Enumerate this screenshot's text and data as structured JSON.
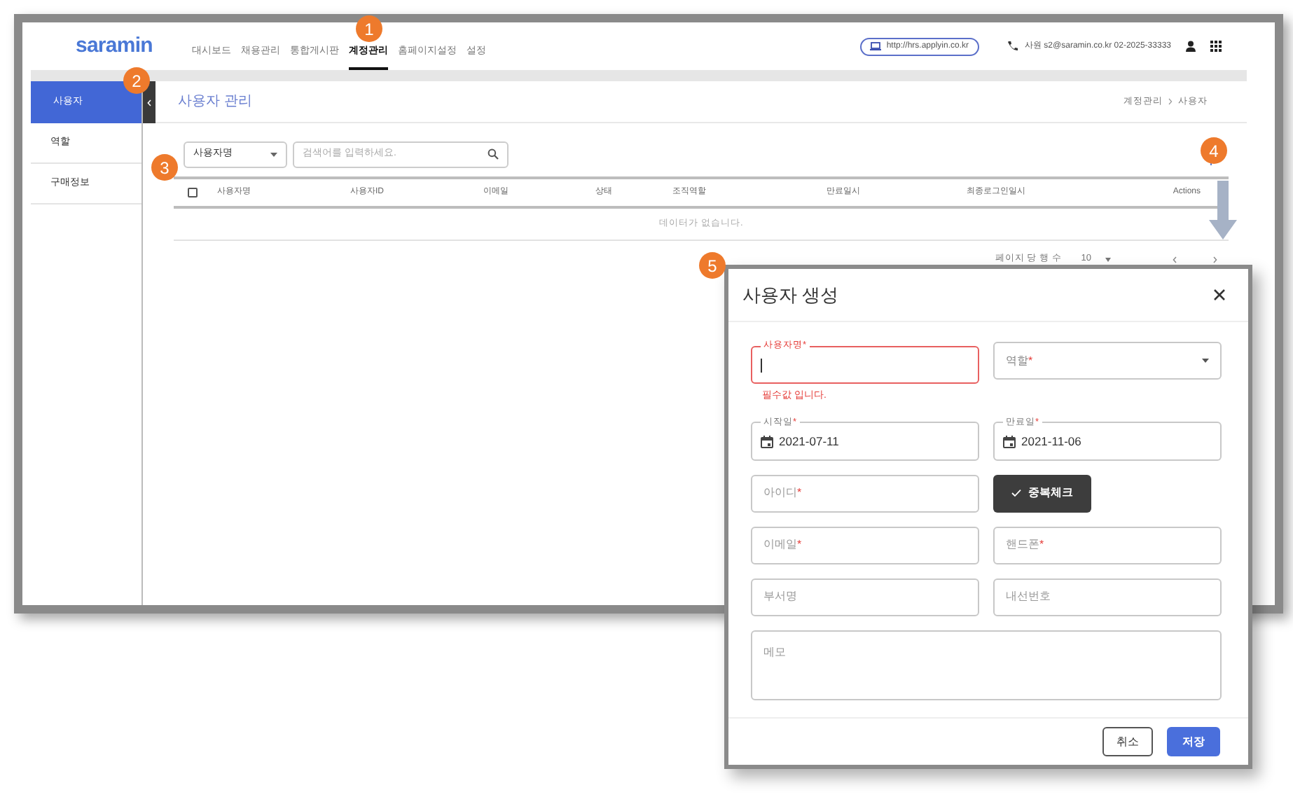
{
  "header": {
    "logo": "saramin",
    "nav": [
      {
        "label": "대시보드",
        "selected": false
      },
      {
        "label": "채용관리",
        "selected": false
      },
      {
        "label": "통합게시판",
        "selected": false
      },
      {
        "label": "계정관리",
        "selected": true
      },
      {
        "label": "홈페이지설정",
        "selected": false
      },
      {
        "label": "설정",
        "selected": false
      }
    ],
    "site_link": "http://hrs.applyin.co.kr",
    "contact": "사원 s2@saramin.co.kr 02-2025-33333"
  },
  "sidebar": {
    "items": [
      {
        "label": "사용자",
        "selected": true
      },
      {
        "label": "역할",
        "selected": false
      },
      {
        "label": "구매정보",
        "selected": false
      }
    ]
  },
  "page": {
    "title": "사용자 관리",
    "breadcrumb": [
      "계정관리",
      "사용자"
    ],
    "filter": {
      "select": "사용자명",
      "search_placeholder": "검색어를 입력하세요."
    },
    "table": {
      "select_all_checked": false,
      "columns": [
        "사용자명",
        "사용자ID",
        "이메일",
        "상태",
        "조직역할",
        "만료일시",
        "최종로그인일시",
        "Actions"
      ],
      "empty_message": "데이터가 없습니다."
    },
    "pagination": {
      "label": "페이지 당 행 수",
      "rows": "10"
    }
  },
  "dialog": {
    "title": "사용자 생성",
    "fields": [
      {
        "kind": "text",
        "label": "사용자명",
        "required_mark": "*",
        "focused": true,
        "invalid": true,
        "error": "필수값 입니다."
      },
      {
        "kind": "select",
        "label": "역할",
        "required_mark": "*"
      },
      {
        "kind": "date",
        "label": "시작일",
        "required_mark": "*",
        "value": "2021-07-11"
      },
      {
        "kind": "date",
        "label": "만료일",
        "required_mark": "*",
        "value": "2021-11-06"
      },
      {
        "kind": "text",
        "label": "아이디",
        "required_mark": "*"
      },
      {
        "kind": "button",
        "label": "중복체크"
      },
      {
        "kind": "text",
        "label": "이메일",
        "required_mark": "*"
      },
      {
        "kind": "text",
        "label": "핸드폰",
        "required_mark": "*"
      },
      {
        "kind": "text",
        "label": "부서명"
      },
      {
        "kind": "text",
        "label": "내선번호"
      },
      {
        "kind": "textarea",
        "label": "메모"
      }
    ],
    "buttons": [
      {
        "label": "취소",
        "kind": "secondary"
      },
      {
        "label": "저장",
        "kind": "primary"
      }
    ]
  },
  "callouts": [
    "1",
    "2",
    "3",
    "4",
    "5"
  ]
}
